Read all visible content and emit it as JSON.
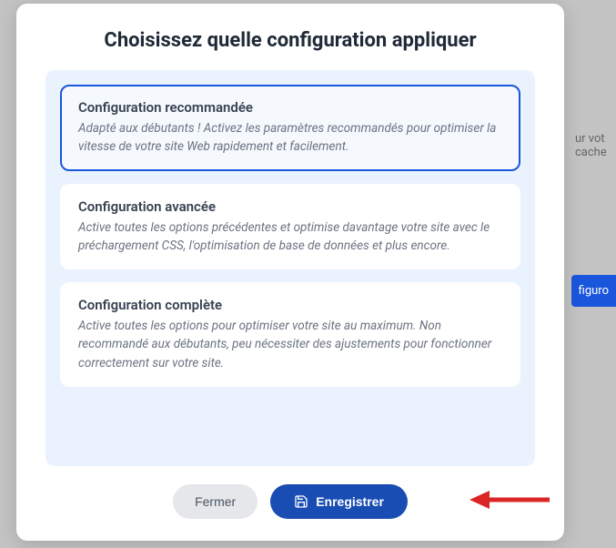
{
  "modal": {
    "title": "Choisissez quelle configuration appliquer",
    "options": [
      {
        "title": "Configuration recommandée",
        "description": "Adapté aux débutants ! Activez les paramètres recommandés pour optimiser la vitesse de votre site Web rapidement et facilement.",
        "selected": true
      },
      {
        "title": "Configuration avancée",
        "description": "Active toutes les options précédentes et optimise davantage votre site avec le préchargement CSS, l'optimisation de base de données et plus encore.",
        "selected": false
      },
      {
        "title": "Configuration complète",
        "description": "Active toutes les options pour optimiser votre site au maximum. Non recommandé aux débutants, peu nécessiter des ajustements pour fonctionner correctement sur votre site.",
        "selected": false
      }
    ],
    "buttons": {
      "close": "Fermer",
      "save": "Enregistrer"
    }
  },
  "background": {
    "fragment_text_1": "ur vot",
    "fragment_text_2": "cache",
    "button_fragment": "figuro"
  }
}
